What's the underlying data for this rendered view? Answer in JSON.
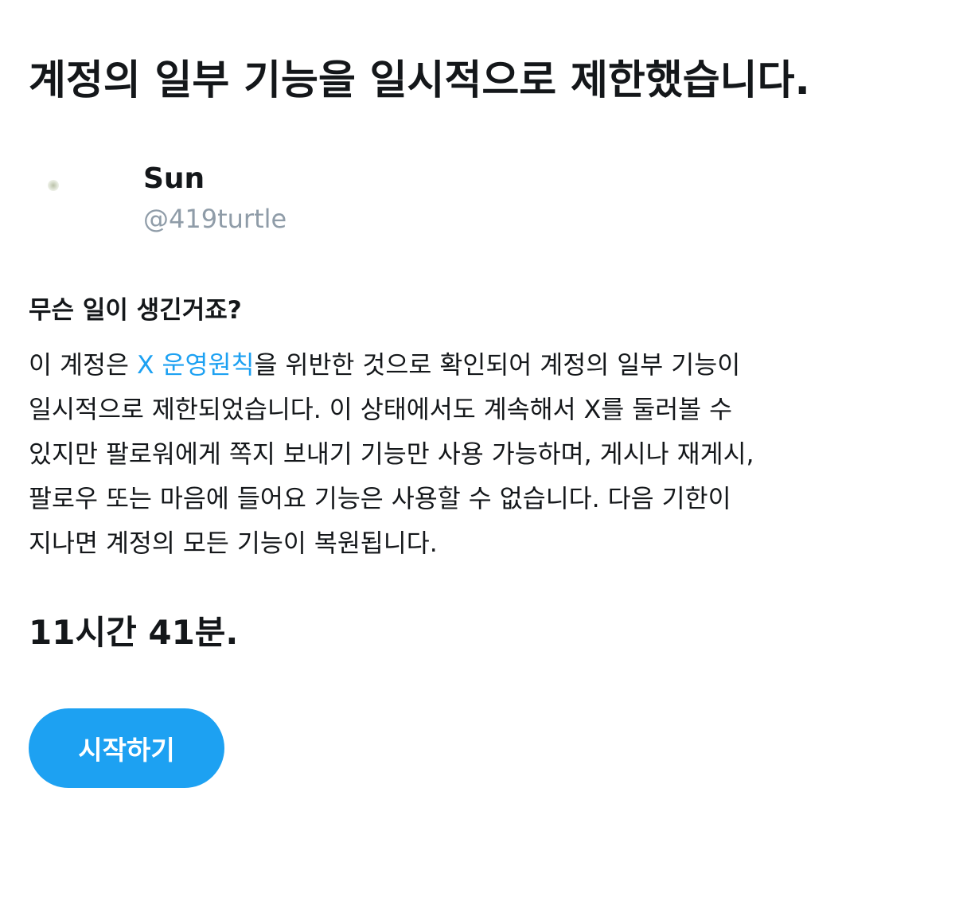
{
  "page": {
    "title": "계정의 일부 기능을 일시적으로 제한했습니다."
  },
  "user": {
    "name": "Sun",
    "handle": "@419turtle"
  },
  "section": {
    "heading": "무슨 일이 생긴거죠?",
    "line1_before": "이 계정은 ",
    "link_text": "X 운영원칙",
    "line1_after": "을 위반한 것으로 확인되어 계정의 일부 기능이",
    "line2": "일시적으로 제한되었습니다. 이 상태에서도 계속해서 X를 둘러볼 수",
    "line3": "있지만 팔로워에게 쪽지 보내기 기능만 사용 가능하며, 게시나 재게시,",
    "line4": "팔로우 또는 마음에 들어요 기능은 사용할 수 없습니다. 다음 기한이",
    "line5": "지나면 계정의 모든 기능이 복원됩니다."
  },
  "restriction": {
    "time_remaining": "11시간 41분."
  },
  "actions": {
    "start_label": "시작하기"
  },
  "colors": {
    "accent": "#1da1f2",
    "text_primary": "#14171a",
    "text_secondary": "#8f9ca8",
    "background": "#ffffff"
  }
}
